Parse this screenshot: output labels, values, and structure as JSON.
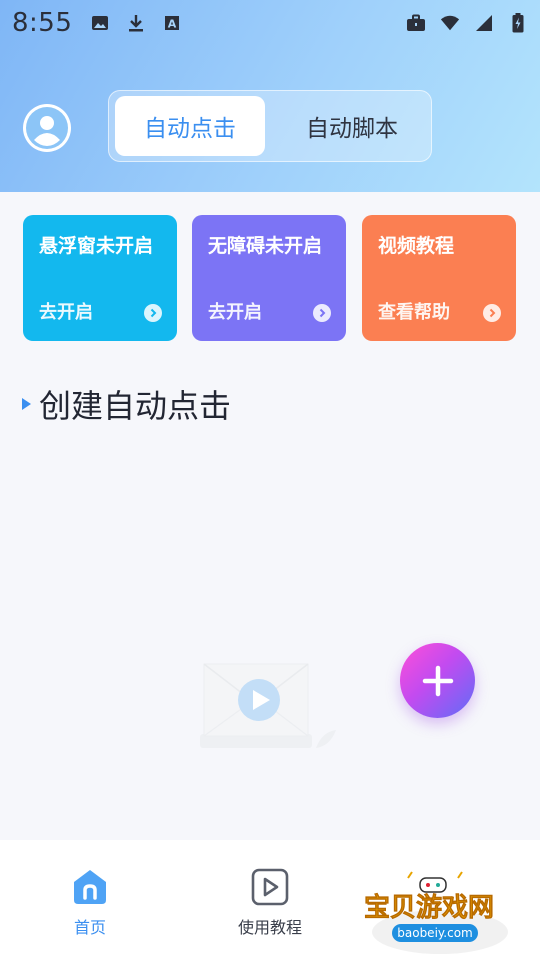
{
  "status_bar": {
    "time": "8:55",
    "left_icons": [
      "image-icon",
      "download-icon",
      "keyboard-a-icon"
    ],
    "right_icons": [
      "briefcase-icon",
      "wifi-icon",
      "signal-icon",
      "battery-charging-icon"
    ]
  },
  "header": {
    "avatar_icon": "user-avatar-icon",
    "tabs": [
      {
        "label": "自动点击",
        "active": true
      },
      {
        "label": "自动脚本",
        "active": false
      }
    ]
  },
  "cards": [
    {
      "title": "悬浮窗未开启",
      "action": "去开启",
      "color": "#13b8ee"
    },
    {
      "title": "无障碍未开启",
      "action": "去开启",
      "color": "#7c74f5"
    },
    {
      "title": "视频教程",
      "action": "查看帮助",
      "color": "#fb7f52"
    }
  ],
  "section": {
    "title": "创建自动点击"
  },
  "fab": {
    "icon": "plus-icon"
  },
  "bottom_nav": [
    {
      "label": "首页",
      "icon": "home-icon",
      "active": true
    },
    {
      "label": "使用教程",
      "icon": "play-square-icon",
      "active": false
    }
  ],
  "watermark": {
    "text": "宝贝游戏网",
    "url_text": "baobeiy.com"
  },
  "colors": {
    "accent": "#3b8ff0",
    "header_gradient_start": "#7fb6f6",
    "header_gradient_end": "#b3e4fc",
    "fab_gradient": [
      "#ff4fd8",
      "#5f6df7"
    ]
  }
}
